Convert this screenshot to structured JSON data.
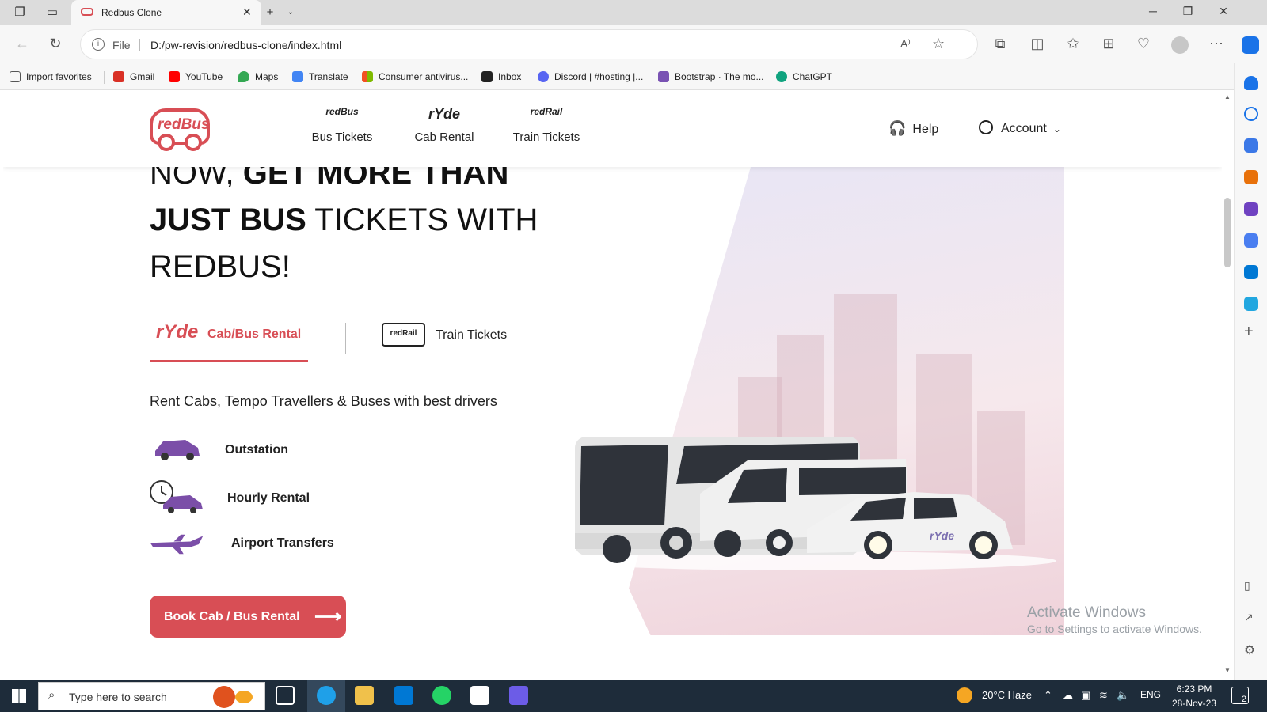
{
  "browser": {
    "tab_title": "Redbus Clone",
    "url_scheme": "File",
    "url": "D:/pw-revision/redbus-clone/index.html"
  },
  "bookmarks": [
    {
      "label": "Import favorites",
      "color": "#555555"
    },
    {
      "label": "Gmail",
      "color": "#d93025"
    },
    {
      "label": "YouTube",
      "color": "#ff0000"
    },
    {
      "label": "Maps",
      "color": "#34a853"
    },
    {
      "label": "Translate",
      "color": "#4285f4"
    },
    {
      "label": "Consumer antivirus...",
      "color": "#f25022"
    },
    {
      "label": "Inbox",
      "color": "#222222"
    },
    {
      "label": "Discord | #hosting |...",
      "color": "#5865f2"
    },
    {
      "label": "Bootstrap · The mo...",
      "color": "#7952b3"
    },
    {
      "label": "ChatGPT",
      "color": "#10a37f"
    }
  ],
  "site": {
    "logo_text": "redBus",
    "nav": [
      {
        "label": "Bus Tickets",
        "icon_text": "redBus"
      },
      {
        "label": "Cab Rental",
        "icon_text": "rYde"
      },
      {
        "label": "Train Tickets",
        "icon_text": "redRail"
      }
    ],
    "help_label": "Help",
    "account_label": "Account"
  },
  "hero": {
    "title_part1": "NOW, ",
    "title_bold1": "GET MORE THAN JUST BUS",
    "title_part2": " TICKETS WITH REDBUS!",
    "tabs": [
      {
        "label": "Cab/Bus Rental",
        "logo": "rYde",
        "active": true
      },
      {
        "label": "Train Tickets",
        "logo": "redRail",
        "active": false
      }
    ],
    "subtitle": "Rent Cabs, Tempo Travellers & Buses with best drivers",
    "options": [
      {
        "label": "Outstation",
        "icon": "car-icon"
      },
      {
        "label": "Hourly Rental",
        "icon": "clock-car-icon"
      },
      {
        "label": "Airport Transfers",
        "icon": "airplane-icon"
      }
    ],
    "cta_label": "Book Cab / Bus Rental",
    "vehicle_badge": "rYde"
  },
  "watermark": {
    "line1": "Activate Windows",
    "line2": "Go to Settings to activate Windows."
  },
  "taskbar": {
    "search_placeholder": "Type here to search",
    "weather": "20°C  Haze",
    "lang": "ENG",
    "time": "6:23 PM",
    "date": "28-Nov-23",
    "notif_count": "2"
  },
  "colors": {
    "brand": "#d84e55",
    "accent_purple": "#7b4ea8"
  }
}
